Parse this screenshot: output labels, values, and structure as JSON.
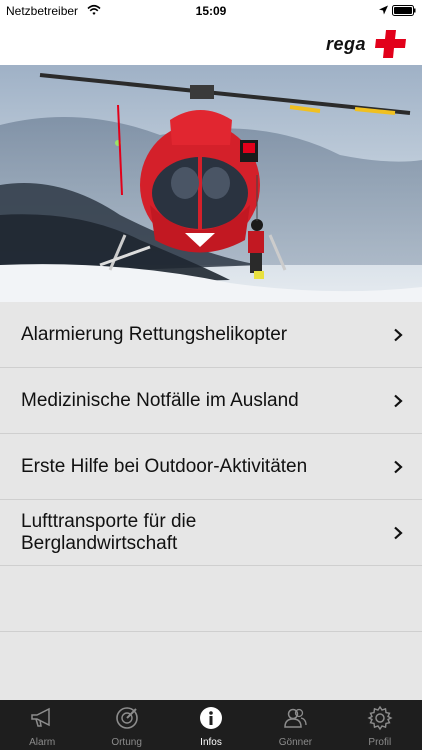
{
  "status_bar": {
    "carrier": "Netzbetreiber",
    "time": "15:09"
  },
  "header": {
    "logo_text": "rega",
    "brand_color": "#e2001a"
  },
  "menu": {
    "items": [
      {
        "label": "Alarmierung Rettungshelikopter"
      },
      {
        "label": "Medizinische Notfälle im Ausland"
      },
      {
        "label": "Erste Hilfe bei Outdoor-Aktivitäten"
      },
      {
        "label": "Lufttransporte für die Berglandwirtschaft"
      }
    ]
  },
  "tabbar": {
    "active_tab": "Infos",
    "tabs": [
      {
        "label": "Alarm",
        "icon": "megaphone-icon"
      },
      {
        "label": "Ortung",
        "icon": "compass-icon"
      },
      {
        "label": "Infos",
        "icon": "info-icon"
      },
      {
        "label": "Gönner",
        "icon": "people-icon"
      },
      {
        "label": "Profil",
        "icon": "gear-icon"
      }
    ]
  }
}
